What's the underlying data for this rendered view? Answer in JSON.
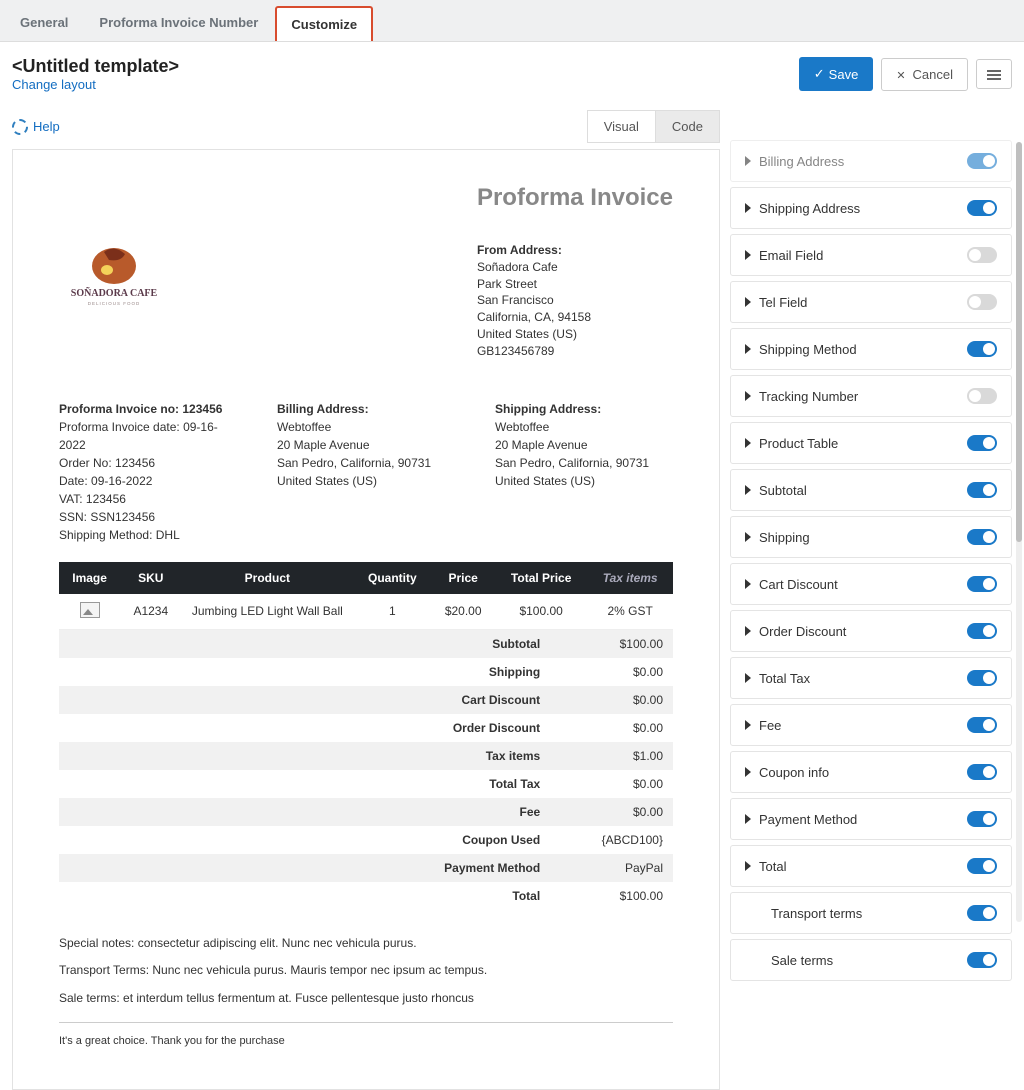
{
  "tabs": {
    "general": "General",
    "proforma": "Proforma Invoice Number",
    "customize": "Customize"
  },
  "header": {
    "title": "<Untitled template>",
    "change_layout": "Change layout",
    "save": "Save",
    "cancel": "Cancel"
  },
  "help_label": "Help",
  "editor_tabs": {
    "visual": "Visual",
    "code": "Code"
  },
  "invoice": {
    "title": "Proforma Invoice",
    "logo_text": "SOÑADORA CAFE",
    "logo_tagline": "DELICIOUS FOOD",
    "from_label": "From Address:",
    "from_lines": [
      "Soñadora Cafe",
      "Park Street",
      "San Francisco",
      "California, CA, 94158",
      "United States (US)",
      "GB123456789"
    ],
    "meta": {
      "no_label": "Proforma Invoice no:",
      "no_val": "123456",
      "date_label": "Proforma Invoice date:",
      "date_val": "09-16-2022",
      "order_label": "Order No:",
      "order_val": "123456",
      "odate_label": "Date:",
      "odate_val": "09-16-2022",
      "vat_label": "VAT:",
      "vat_val": "123456",
      "ssn_label": "SSN:",
      "ssn_val": "SSN123456",
      "ship_label": "Shipping Method:",
      "ship_val": "DHL"
    },
    "billing_label": "Billing Address:",
    "billing_lines": [
      "Webtoffee",
      "20 Maple Avenue",
      "San Pedro, California, 90731",
      "United States (US)"
    ],
    "shipping_label": "Shipping Address:",
    "shipping_lines": [
      "Webtoffee",
      "20 Maple Avenue",
      "San Pedro, California, 90731",
      "United States (US)"
    ],
    "columns": [
      "Image",
      "SKU",
      "Product",
      "Quantity",
      "Price",
      "Total Price",
      "Tax items"
    ],
    "row": {
      "sku": "A1234",
      "product": "Jumbing LED Light Wall Ball",
      "qty": "1",
      "price": "$20.00",
      "total": "$100.00",
      "tax": "2% GST"
    },
    "totals": [
      {
        "label": "Subtotal",
        "val": "$100.00"
      },
      {
        "label": "Shipping",
        "val": "$0.00"
      },
      {
        "label": "Cart Discount",
        "val": "$0.00"
      },
      {
        "label": "Order Discount",
        "val": "$0.00"
      },
      {
        "label": "Tax items",
        "val": "$1.00"
      },
      {
        "label": "Total Tax",
        "val": "$0.00"
      },
      {
        "label": "Fee",
        "val": "$0.00"
      },
      {
        "label": "Coupon Used",
        "val": "{ABCD100}"
      },
      {
        "label": "Payment Method",
        "val": "PayPal"
      },
      {
        "label": "Total",
        "val": "$100.00"
      }
    ],
    "note1": "Special notes: consectetur adipiscing elit. Nunc nec vehicula purus.",
    "note2": "Transport Terms: Nunc nec vehicula purus. Mauris tempor nec ipsum ac tempus.",
    "note3": "Sale terms: et interdum tellus fermentum at. Fusce pellentesque justo rhoncus",
    "thank": "It's a great choice. Thank you for the purchase"
  },
  "panels": [
    {
      "label": "Billing Address",
      "on": true,
      "faded": true
    },
    {
      "label": "Shipping Address",
      "on": true
    },
    {
      "label": "Email Field",
      "on": false
    },
    {
      "label": "Tel Field",
      "on": false
    },
    {
      "label": "Shipping Method",
      "on": true
    },
    {
      "label": "Tracking Number",
      "on": false
    },
    {
      "label": "Product Table",
      "on": true
    },
    {
      "label": "Subtotal",
      "on": true
    },
    {
      "label": "Shipping",
      "on": true
    },
    {
      "label": "Cart Discount",
      "on": true
    },
    {
      "label": "Order Discount",
      "on": true
    },
    {
      "label": "Total Tax",
      "on": true
    },
    {
      "label": "Fee",
      "on": true
    },
    {
      "label": "Coupon info",
      "on": true
    },
    {
      "label": "Payment Method",
      "on": true
    },
    {
      "label": "Total",
      "on": true
    },
    {
      "label": "Transport terms",
      "on": true,
      "indent": true
    },
    {
      "label": "Sale terms",
      "on": true,
      "indent": true
    }
  ]
}
